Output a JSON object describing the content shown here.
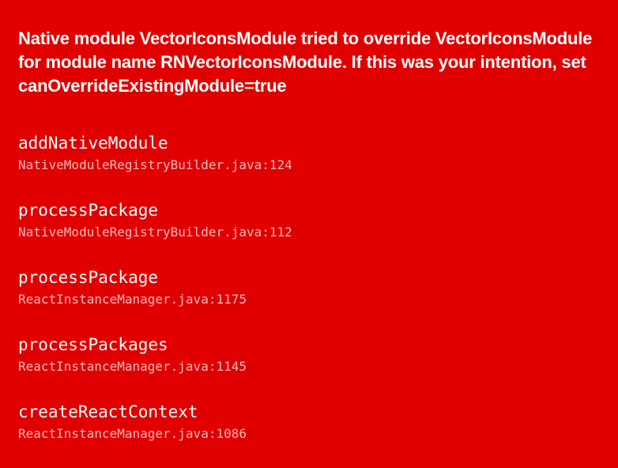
{
  "error": {
    "message": "Native module VectorIconsModule tried to override VectorIconsModule for module name RNVectorIconsModule. If this was your intention, set canOverrideExistingModule=true"
  },
  "stack_trace": [
    {
      "method": "addNativeModule",
      "location": "NativeModuleRegistryBuilder.java:124"
    },
    {
      "method": "processPackage",
      "location": "NativeModuleRegistryBuilder.java:112"
    },
    {
      "method": "processPackage",
      "location": "ReactInstanceManager.java:1175"
    },
    {
      "method": "processPackages",
      "location": "ReactInstanceManager.java:1145"
    },
    {
      "method": "createReactContext",
      "location": "ReactInstanceManager.java:1086"
    }
  ],
  "colors": {
    "background": "#e00000",
    "text": "#ffffff"
  }
}
